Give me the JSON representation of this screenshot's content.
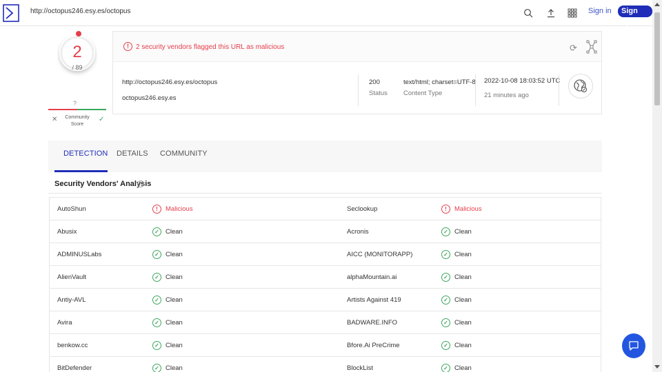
{
  "topbar": {
    "url": "http://octopus246.esy.es/octopus",
    "sign_in": "Sign in",
    "sign_up": "Sign up"
  },
  "score": {
    "detections": "2",
    "total": "/ 89",
    "community_unknown": "?",
    "community_label_1": "Community",
    "community_label_2": "Score"
  },
  "summary": {
    "alert": "2 security vendors flagged this URL as malicious",
    "url": "http://octopus246.esy.es/octopus",
    "domain": "octopus246.esy.es",
    "status_value": "200",
    "status_label": "Status",
    "content_type_value": "text/html; charset=UTF-8",
    "content_type_label": "Content Type",
    "date": "2022-10-08 18:03:52 UTC",
    "age": "21 minutes ago"
  },
  "tabs": [
    {
      "label": "DETECTION"
    },
    {
      "label": "DETAILS"
    },
    {
      "label": "COMMUNITY"
    }
  ],
  "section_title": "Security Vendors' Analysis",
  "vendors": [
    [
      {
        "name": "AutoShun",
        "result": "Malicious"
      },
      {
        "name": "Seclookup",
        "result": "Malicious"
      }
    ],
    [
      {
        "name": "Abusix",
        "result": "Clean"
      },
      {
        "name": "Acronis",
        "result": "Clean"
      }
    ],
    [
      {
        "name": "ADMINUSLabs",
        "result": "Clean"
      },
      {
        "name": "AICC (MONITORAPP)",
        "result": "Clean"
      }
    ],
    [
      {
        "name": "AlienVault",
        "result": "Clean"
      },
      {
        "name": "alphaMountain.ai",
        "result": "Clean"
      }
    ],
    [
      {
        "name": "Antiy-AVL",
        "result": "Clean"
      },
      {
        "name": "Artists Against 419",
        "result": "Clean"
      }
    ],
    [
      {
        "name": "Avira",
        "result": "Clean"
      },
      {
        "name": "BADWARE.INFO",
        "result": "Clean"
      }
    ],
    [
      {
        "name": "benkow.cc",
        "result": "Clean"
      },
      {
        "name": "Bfore.Ai PreCrime",
        "result": "Clean"
      }
    ],
    [
      {
        "name": "BitDefender",
        "result": "Clean"
      },
      {
        "name": "BlockList",
        "result": "Clean"
      }
    ]
  ],
  "colors": {
    "malicious": "#e53e4b",
    "clean": "#3ca65c",
    "brand": "#1f2db8"
  }
}
